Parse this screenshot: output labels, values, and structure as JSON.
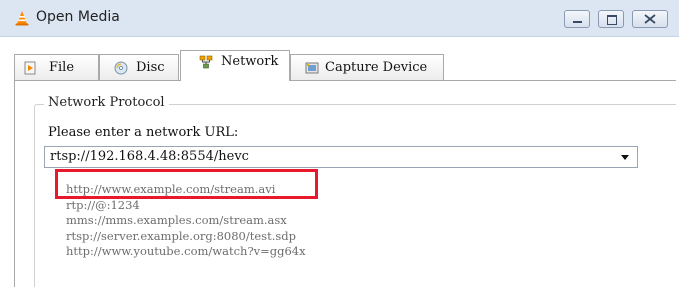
{
  "dialog": {
    "title": "Open Media",
    "min_label": "minimize",
    "max_label": "maximize",
    "close_label": "close"
  },
  "tabs": [
    {
      "label": "File",
      "icon": "file-icon"
    },
    {
      "label": "Disc",
      "icon": "disc-icon"
    },
    {
      "label": "Network",
      "icon": "network-icon",
      "active": true
    },
    {
      "label": "Capture Device",
      "icon": "capture-icon"
    }
  ],
  "network": {
    "group_title": "Network Protocol",
    "prompt": "Please enter a network URL:",
    "url_value": "rtsp://192.168.4.48:8554/hevc",
    "examples": [
      "http://www.example.com/stream.avi",
      "rtp://@:1234",
      "mms://mms.examples.com/stream.asx",
      "rtsp://server.example.org:8080/test.sdp",
      "http://www.youtube.com/watch?v=gg64x"
    ]
  },
  "colors": {
    "highlight": "#e8192c",
    "accent_orange": "#ff8a00"
  }
}
